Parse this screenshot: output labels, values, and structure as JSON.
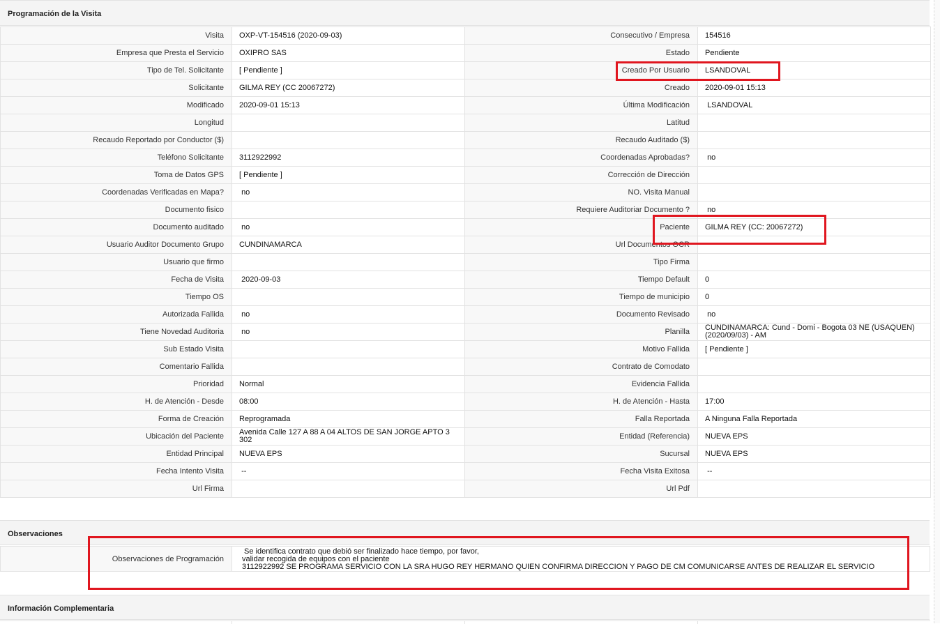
{
  "sections": {
    "programacion": "Programación de la Visita",
    "observaciones": "Observaciones",
    "complementaria": "Información Complementaria"
  },
  "rows": [
    {
      "l1": "Visita",
      "v1": "OXP-VT-154516 (2020-09-03)",
      "l2": "Consecutivo / Empresa",
      "v2": "154516"
    },
    {
      "l1": "Empresa que Presta el Servicio",
      "v1": "OXIPRO SAS",
      "l2": "Estado",
      "v2": "Pendiente"
    },
    {
      "l1": "Tipo de Tel. Solicitante",
      "v1": "[ Pendiente ]",
      "l2": "Creado Por Usuario",
      "v2": "LSANDOVAL"
    },
    {
      "l1": "Solicitante",
      "v1": "GILMA REY (CC 20067272)",
      "l2": "Creado",
      "v2": "2020-09-01 15:13"
    },
    {
      "l1": "Modificado",
      "v1": "2020-09-01 15:13",
      "l2": "Última Modificación",
      "v2": " LSANDOVAL"
    },
    {
      "l1": "Longitud",
      "v1": "",
      "l2": "Latitud",
      "v2": ""
    },
    {
      "l1": "Recaudo Reportado por Conductor ($)",
      "v1": "",
      "l2": "Recaudo Auditado ($)",
      "v2": ""
    },
    {
      "l1": "Teléfono Solicitante",
      "v1": "3112922992",
      "l2": "Coordenadas Aprobadas?",
      "v2": " no"
    },
    {
      "l1": "Toma de Datos GPS",
      "v1": "[ Pendiente ]",
      "l2": "Corrección de Dirección",
      "v2": ""
    },
    {
      "l1": "Coordenadas Verificadas en Mapa?",
      "v1": " no",
      "l2": "NO. Visita Manual",
      "v2": ""
    },
    {
      "l1": "Documento fisico",
      "v1": "",
      "l2": "Requiere Auditoriar Documento ?",
      "v2": " no"
    },
    {
      "l1": "Documento auditado",
      "v1": " no",
      "l2": "Paciente",
      "v2": "GILMA REY (CC: 20067272)"
    },
    {
      "l1": "Usuario Auditor Documento Grupo",
      "v1": "CUNDINAMARCA",
      "l2": "Url Documentos OCR",
      "v2": ""
    },
    {
      "l1": "Usuario que firmo",
      "v1": "",
      "l2": "Tipo Firma",
      "v2": ""
    },
    {
      "l1": "Fecha de Visita",
      "v1": " 2020-09-03",
      "l2": "Tiempo Default",
      "v2": "0"
    },
    {
      "l1": "Tiempo OS",
      "v1": "",
      "l2": "Tiempo de municipio",
      "v2": "0"
    },
    {
      "l1": "Autorizada Fallida",
      "v1": " no",
      "l2": "Documento Revisado",
      "v2": " no"
    },
    {
      "l1": "Tiene Novedad Auditoria",
      "v1": " no",
      "l2": "Planilla",
      "v2": "CUNDINAMARCA: Cund - Domi - Bogota 03 NE (USAQUEN) (2020/09/03) - AM"
    },
    {
      "l1": "Sub Estado Visita",
      "v1": "",
      "l2": "Motivo Fallida",
      "v2": "[ Pendiente ]"
    },
    {
      "l1": "Comentario Fallida",
      "v1": "",
      "l2": "Contrato de Comodato",
      "v2": ""
    },
    {
      "l1": "Prioridad",
      "v1": "Normal",
      "l2": "Evidencia Fallida",
      "v2": ""
    },
    {
      "l1": "H. de Atención - Desde",
      "v1": "08:00",
      "l2": "H. de Atención - Hasta",
      "v2": "17:00"
    },
    {
      "l1": "Forma de Creación",
      "v1": "Reprogramada",
      "l2": "Falla Reportada",
      "v2": "A Ninguna Falla Reportada"
    },
    {
      "l1": "Ubicación del Paciente",
      "v1": "Avenida Calle 127 A 88 A 04 ALTOS DE SAN JORGE APTO 3 302",
      "l2": "Entidad (Referencia)",
      "v2": "NUEVA EPS"
    },
    {
      "l1": "Entidad Principal",
      "v1": "NUEVA EPS",
      "l2": "Sucursal",
      "v2": "NUEVA EPS"
    },
    {
      "l1": "Fecha Intento Visita",
      "v1": " --",
      "l2": "Fecha Visita Exitosa",
      "v2": " --"
    },
    {
      "l1": "Url Firma",
      "v1": "",
      "l2": "Url Pdf",
      "v2": ""
    }
  ],
  "observaciones": {
    "label": "Observaciones de Programación",
    "lines": [
      " Se identifica contrato que debió ser finalizado hace tiempo, por favor,",
      "validar recogida de equipos con el paciente",
      "3112922992 SE PROGRAMA SERVICIO CON LA SRA HUGO REY HERMANO QUIEN CONFIRMA DIRECCION Y PAGO DE CM COMUNICARSE ANTES DE REALIZAR EL SERVICIO"
    ]
  },
  "colors": {
    "highlight": "#e0161f",
    "header_bg": "#f4f4f4",
    "border": "#e2e2e2"
  }
}
